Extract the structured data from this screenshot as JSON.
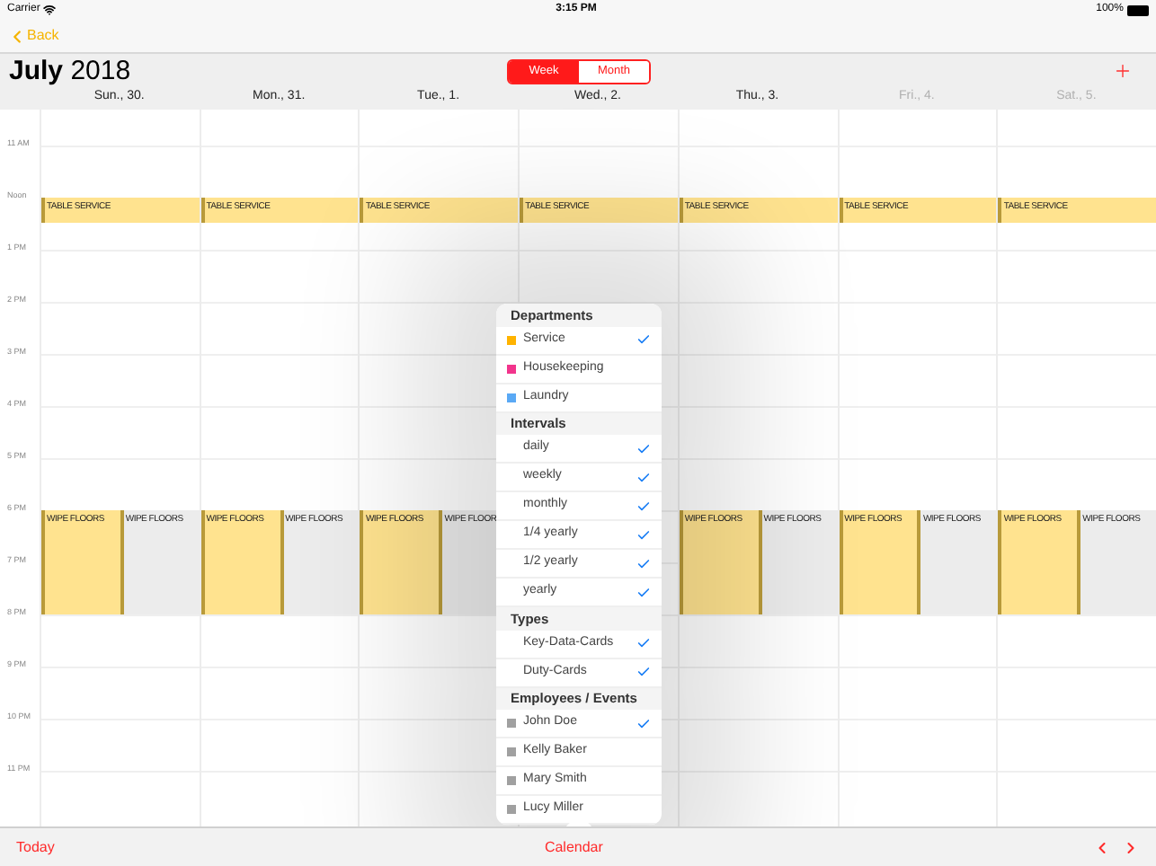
{
  "status_bar": {
    "carrier": "Carrier",
    "time": "3:15 PM",
    "battery": "100%"
  },
  "nav": {
    "back": "Back"
  },
  "header": {
    "month": "July",
    "year": "2018",
    "segments": [
      {
        "label": "Week",
        "selected": true
      },
      {
        "label": "Month",
        "selected": false
      }
    ]
  },
  "hours": [
    "11 AM",
    "Noon",
    "1 PM",
    "2 PM",
    "3 PM",
    "4 PM",
    "5 PM",
    "6 PM",
    "7 PM",
    "8 PM",
    "9 PM",
    "10 PM",
    "11 PM"
  ],
  "days": [
    {
      "label": "Sun., 30.",
      "disabled": false,
      "events": [
        {
          "title": "TABLE SERVICE",
          "kind": "noon",
          "color": "#ffe38f"
        },
        {
          "title": "WIPE FLOORS",
          "kind": "left",
          "color": "#ffe38f"
        },
        {
          "title": "WIPE FLOORS",
          "kind": "right",
          "color": "#ececec"
        }
      ]
    },
    {
      "label": "Mon., 31.",
      "disabled": false,
      "events": [
        {
          "title": "TABLE SERVICE",
          "kind": "noon",
          "color": "#ffe38f"
        },
        {
          "title": "WIPE FLOORS",
          "kind": "left",
          "color": "#ffe38f"
        },
        {
          "title": "WIPE FLOORS",
          "kind": "right",
          "color": "#ececec"
        }
      ]
    },
    {
      "label": "Tue., 1.",
      "disabled": false,
      "events": [
        {
          "title": "TABLE SERVICE",
          "kind": "noon",
          "color": "#ffe38f"
        },
        {
          "title": "WIPE FLOORS",
          "kind": "left",
          "color": "#ffe38f"
        },
        {
          "title": "WIPE FLOOR",
          "kind": "right",
          "color": "#ececec"
        }
      ]
    },
    {
      "label": "Wed., 2.",
      "disabled": false,
      "events": [
        {
          "title": "TABLE SERVICE",
          "kind": "noon",
          "color": "#ffe38f"
        }
      ]
    },
    {
      "label": "Thu., 3.",
      "disabled": false,
      "events": [
        {
          "title": "TABLE SERVICE",
          "kind": "noon",
          "color": "#ffe38f"
        },
        {
          "title": "WIPE FLOORS",
          "kind": "left",
          "color": "#ffe38f"
        },
        {
          "title": "WIPE FLOORS",
          "kind": "right",
          "color": "#ececec"
        }
      ]
    },
    {
      "label": "Fri., 4.",
      "disabled": true,
      "events": [
        {
          "title": "TABLE SERVICE",
          "kind": "noon",
          "color": "#ffe38f"
        },
        {
          "title": "WIPE FLOORS",
          "kind": "left",
          "color": "#ffe38f"
        },
        {
          "title": "WIPE FLOORS",
          "kind": "right",
          "color": "#ececec"
        }
      ]
    },
    {
      "label": "Sat., 5.",
      "disabled": true,
      "events": [
        {
          "title": "TABLE SERVICE",
          "kind": "noon",
          "color": "#ffe38f"
        },
        {
          "title": "WIPE FLOORS",
          "kind": "left",
          "color": "#ffe38f"
        },
        {
          "title": "WIPE FLOORS",
          "kind": "right",
          "color": "#ececec"
        }
      ]
    }
  ],
  "popover": {
    "sections": [
      {
        "title": "Departments",
        "items": [
          {
            "label": "Service",
            "kind": "department",
            "color": "#ffb300",
            "checked": true
          },
          {
            "label": "Housekeeping",
            "kind": "department",
            "color": "#f2348c",
            "checked": false
          },
          {
            "label": "Laundry",
            "kind": "department",
            "color": "#5aa9f5",
            "checked": false
          }
        ]
      },
      {
        "title": "Intervals",
        "items": [
          {
            "label": "daily",
            "kind": "plain",
            "checked": true
          },
          {
            "label": "weekly",
            "kind": "plain",
            "checked": true
          },
          {
            "label": "monthly",
            "kind": "plain",
            "checked": true
          },
          {
            "label": "1/4 yearly",
            "kind": "plain",
            "checked": true
          },
          {
            "label": "1/2 yearly",
            "kind": "plain",
            "checked": true
          },
          {
            "label": "yearly",
            "kind": "plain",
            "checked": true
          }
        ]
      },
      {
        "title": "Types",
        "items": [
          {
            "label": "Key-Data-Cards",
            "kind": "plain",
            "checked": true
          },
          {
            "label": "Duty-Cards",
            "kind": "plain",
            "checked": true
          }
        ]
      },
      {
        "title": "Employees / Events",
        "items": [
          {
            "label": "John Doe",
            "kind": "employee",
            "checked": true
          },
          {
            "label": "Kelly Baker",
            "kind": "employee",
            "checked": false
          },
          {
            "label": "Mary Smith",
            "kind": "employee",
            "checked": false
          },
          {
            "label": "Lucy Miller",
            "kind": "employee",
            "checked": false
          }
        ]
      }
    ]
  },
  "toolbar": {
    "today": "Today",
    "title": "Calendar"
  }
}
